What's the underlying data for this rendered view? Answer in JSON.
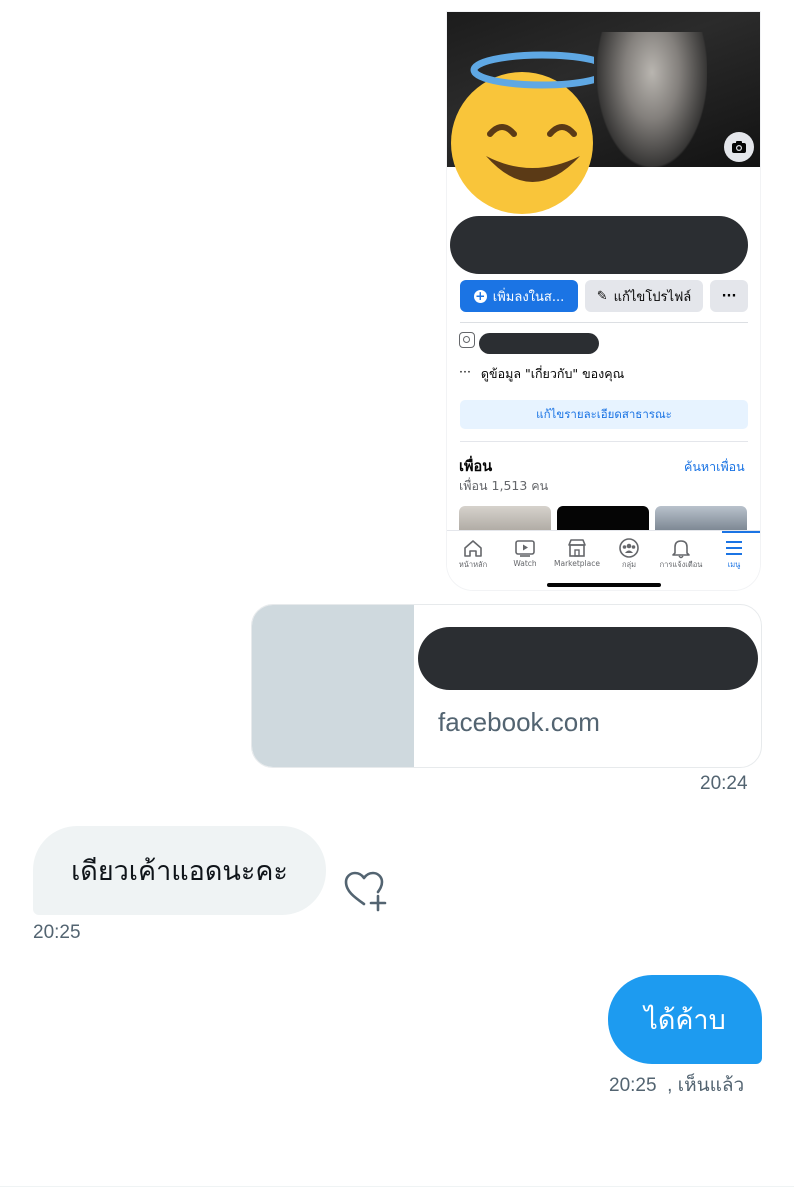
{
  "shared_screenshot": {
    "add_story_button": "เพิ่มลงในส...",
    "edit_profile_button": "แก้ไขโปรไฟล์",
    "more_button": "···",
    "about_ellipsis": "···",
    "about_text": "ดูข้อมูล \"เกี่ยวกับ\" ของคุณ",
    "edit_public_details": "แก้ไขรายละเอียดสาธารณะ",
    "friends_title": "เพื่อน",
    "find_friends": "ค้นหาเพื่อน",
    "friends_count": "เพื่อน 1,513 คน",
    "tabs": [
      {
        "label": "หน้าหลัก",
        "icon": "home-icon"
      },
      {
        "label": "Watch",
        "icon": "watch-icon"
      },
      {
        "label": "Marketplace",
        "icon": "marketplace-icon"
      },
      {
        "label": "กลุ่ม",
        "icon": "groups-icon"
      },
      {
        "label": "การแจ้งเตือน",
        "icon": "bell-icon"
      },
      {
        "label": "เมนู",
        "icon": "menu-icon"
      }
    ],
    "active_tab": "เมนู"
  },
  "link_card": {
    "domain": "facebook.com",
    "time": "20:24"
  },
  "received_message": {
    "text": "เดียวเค้าแอดนะคะ",
    "time": "20:25"
  },
  "sent_message": {
    "text": "ได้ค้าบ",
    "time_status": "20:25  , เห็นแล้ว"
  },
  "colors": {
    "sent_bubble": "#1d9bf0",
    "received_bubble": "#eff3f4",
    "facebook_blue": "#1b74e4",
    "muted_text": "#536471"
  }
}
